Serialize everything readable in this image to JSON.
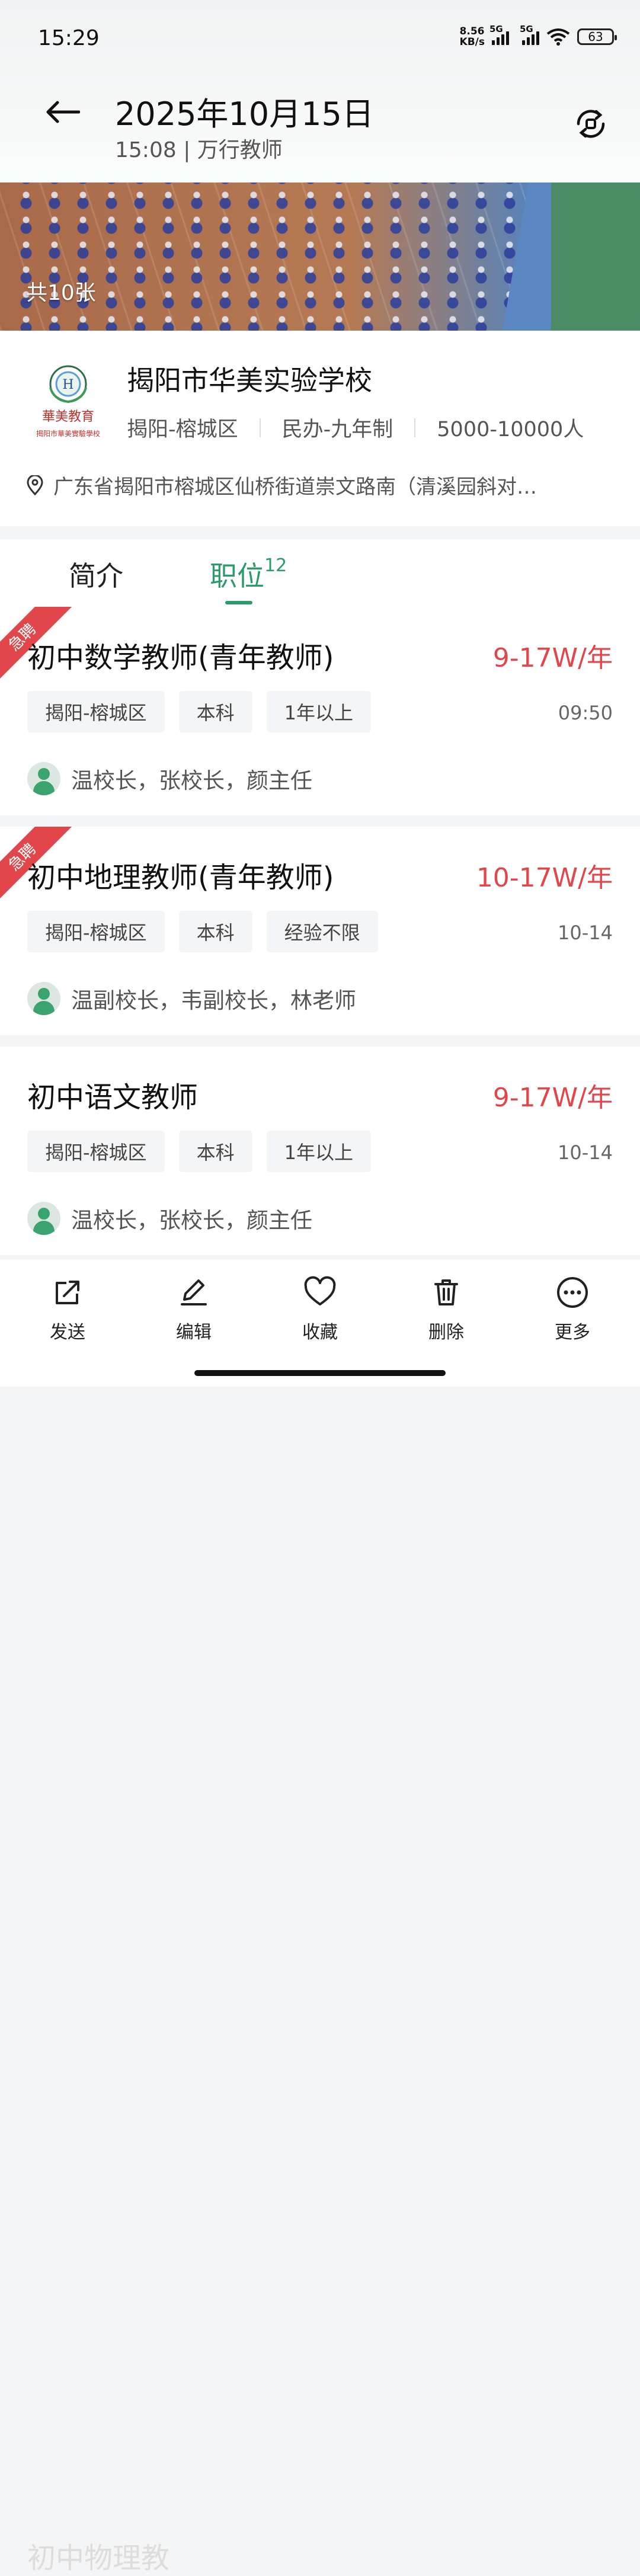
{
  "status_bar": {
    "time": "15:29",
    "net_speed_line1": "8.56",
    "net_speed_line2": "KB/s",
    "sim1": "5G",
    "sim2": "5G",
    "battery": "63"
  },
  "header": {
    "title": "2025年10月15日",
    "subtitle": "15:08 | 万行教师"
  },
  "banner": {
    "photo_count": "共10张"
  },
  "school": {
    "name": "揭阳市华美实验学校",
    "region": "揭阳-榕城区",
    "type": "民办-九年制",
    "size": "5000-10000人",
    "address": "广东省揭阳市榕城区仙桥街道崇文路南（清溪园斜对…",
    "logo_text_1": "華美教育",
    "logo_text_2": "揭阳市華美實驗學校"
  },
  "tabs": {
    "intro": "简介",
    "jobs": "职位",
    "jobs_count": "12"
  },
  "jobs": [
    {
      "badge": "急聘",
      "title": "初中数学教师(青年教师)",
      "salary": "9-17W/年",
      "tags": [
        "揭阳-榕城区",
        "本科",
        "1年以上"
      ],
      "date": "09:50",
      "contacts": "温校长，张校长，颜主任"
    },
    {
      "badge": "急聘",
      "title": "初中地理教师(青年教师)",
      "salary": "10-17W/年",
      "tags": [
        "揭阳-榕城区",
        "本科",
        "经验不限"
      ],
      "date": "10-14",
      "contacts": "温副校长，韦副校长，林老师"
    },
    {
      "badge": "",
      "title": "初中语文教师",
      "salary": "9-17W/年",
      "tags": [
        "揭阳-榕城区",
        "本科",
        "1年以上"
      ],
      "date": "10-14",
      "contacts": "温校长，张校长，颜主任"
    }
  ],
  "peek_title": "初中物理教",
  "toolbar": {
    "send": "发送",
    "edit": "编辑",
    "favorite": "收藏",
    "delete": "删除",
    "more": "更多"
  },
  "colors": {
    "accent_green": "#2d9a6a",
    "salary_red": "#e0464a"
  }
}
